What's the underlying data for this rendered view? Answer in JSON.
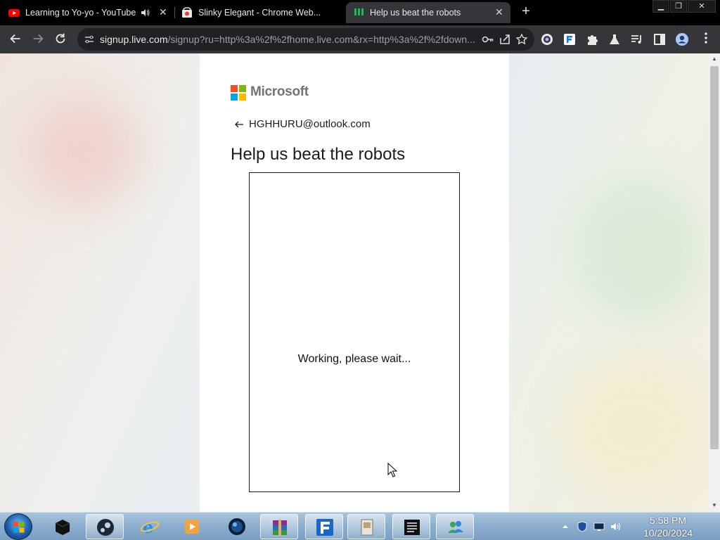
{
  "browser": {
    "tabs": [
      {
        "title": "Learning to Yo-yo - YouTube",
        "audio": true,
        "active": false
      },
      {
        "title": "Slinky Elegant - Chrome Web...",
        "active": false
      },
      {
        "title": "Help us beat the robots",
        "active": true
      }
    ],
    "new_tab_label": "+",
    "window_controls": [
      "minimize",
      "restore",
      "close"
    ],
    "url_host": "signup.live.com",
    "url_rest": "/signup?ru=http%3a%2f%2fhome.live.com&rx=http%3a%2f%2fdown..."
  },
  "page": {
    "brand": "Microsoft",
    "email": "HGHHURU@outlook.com",
    "heading": "Help us beat the robots",
    "captcha_status": "Working, please wait..."
  },
  "taskbar": {
    "time": "5:58 PM",
    "date": "10/20/2024"
  },
  "colors": {
    "ms_red": "#f25022",
    "ms_green": "#7fba00",
    "ms_blue": "#00a4ef",
    "ms_yellow": "#ffb900",
    "chrome_dark": "#35363a"
  }
}
